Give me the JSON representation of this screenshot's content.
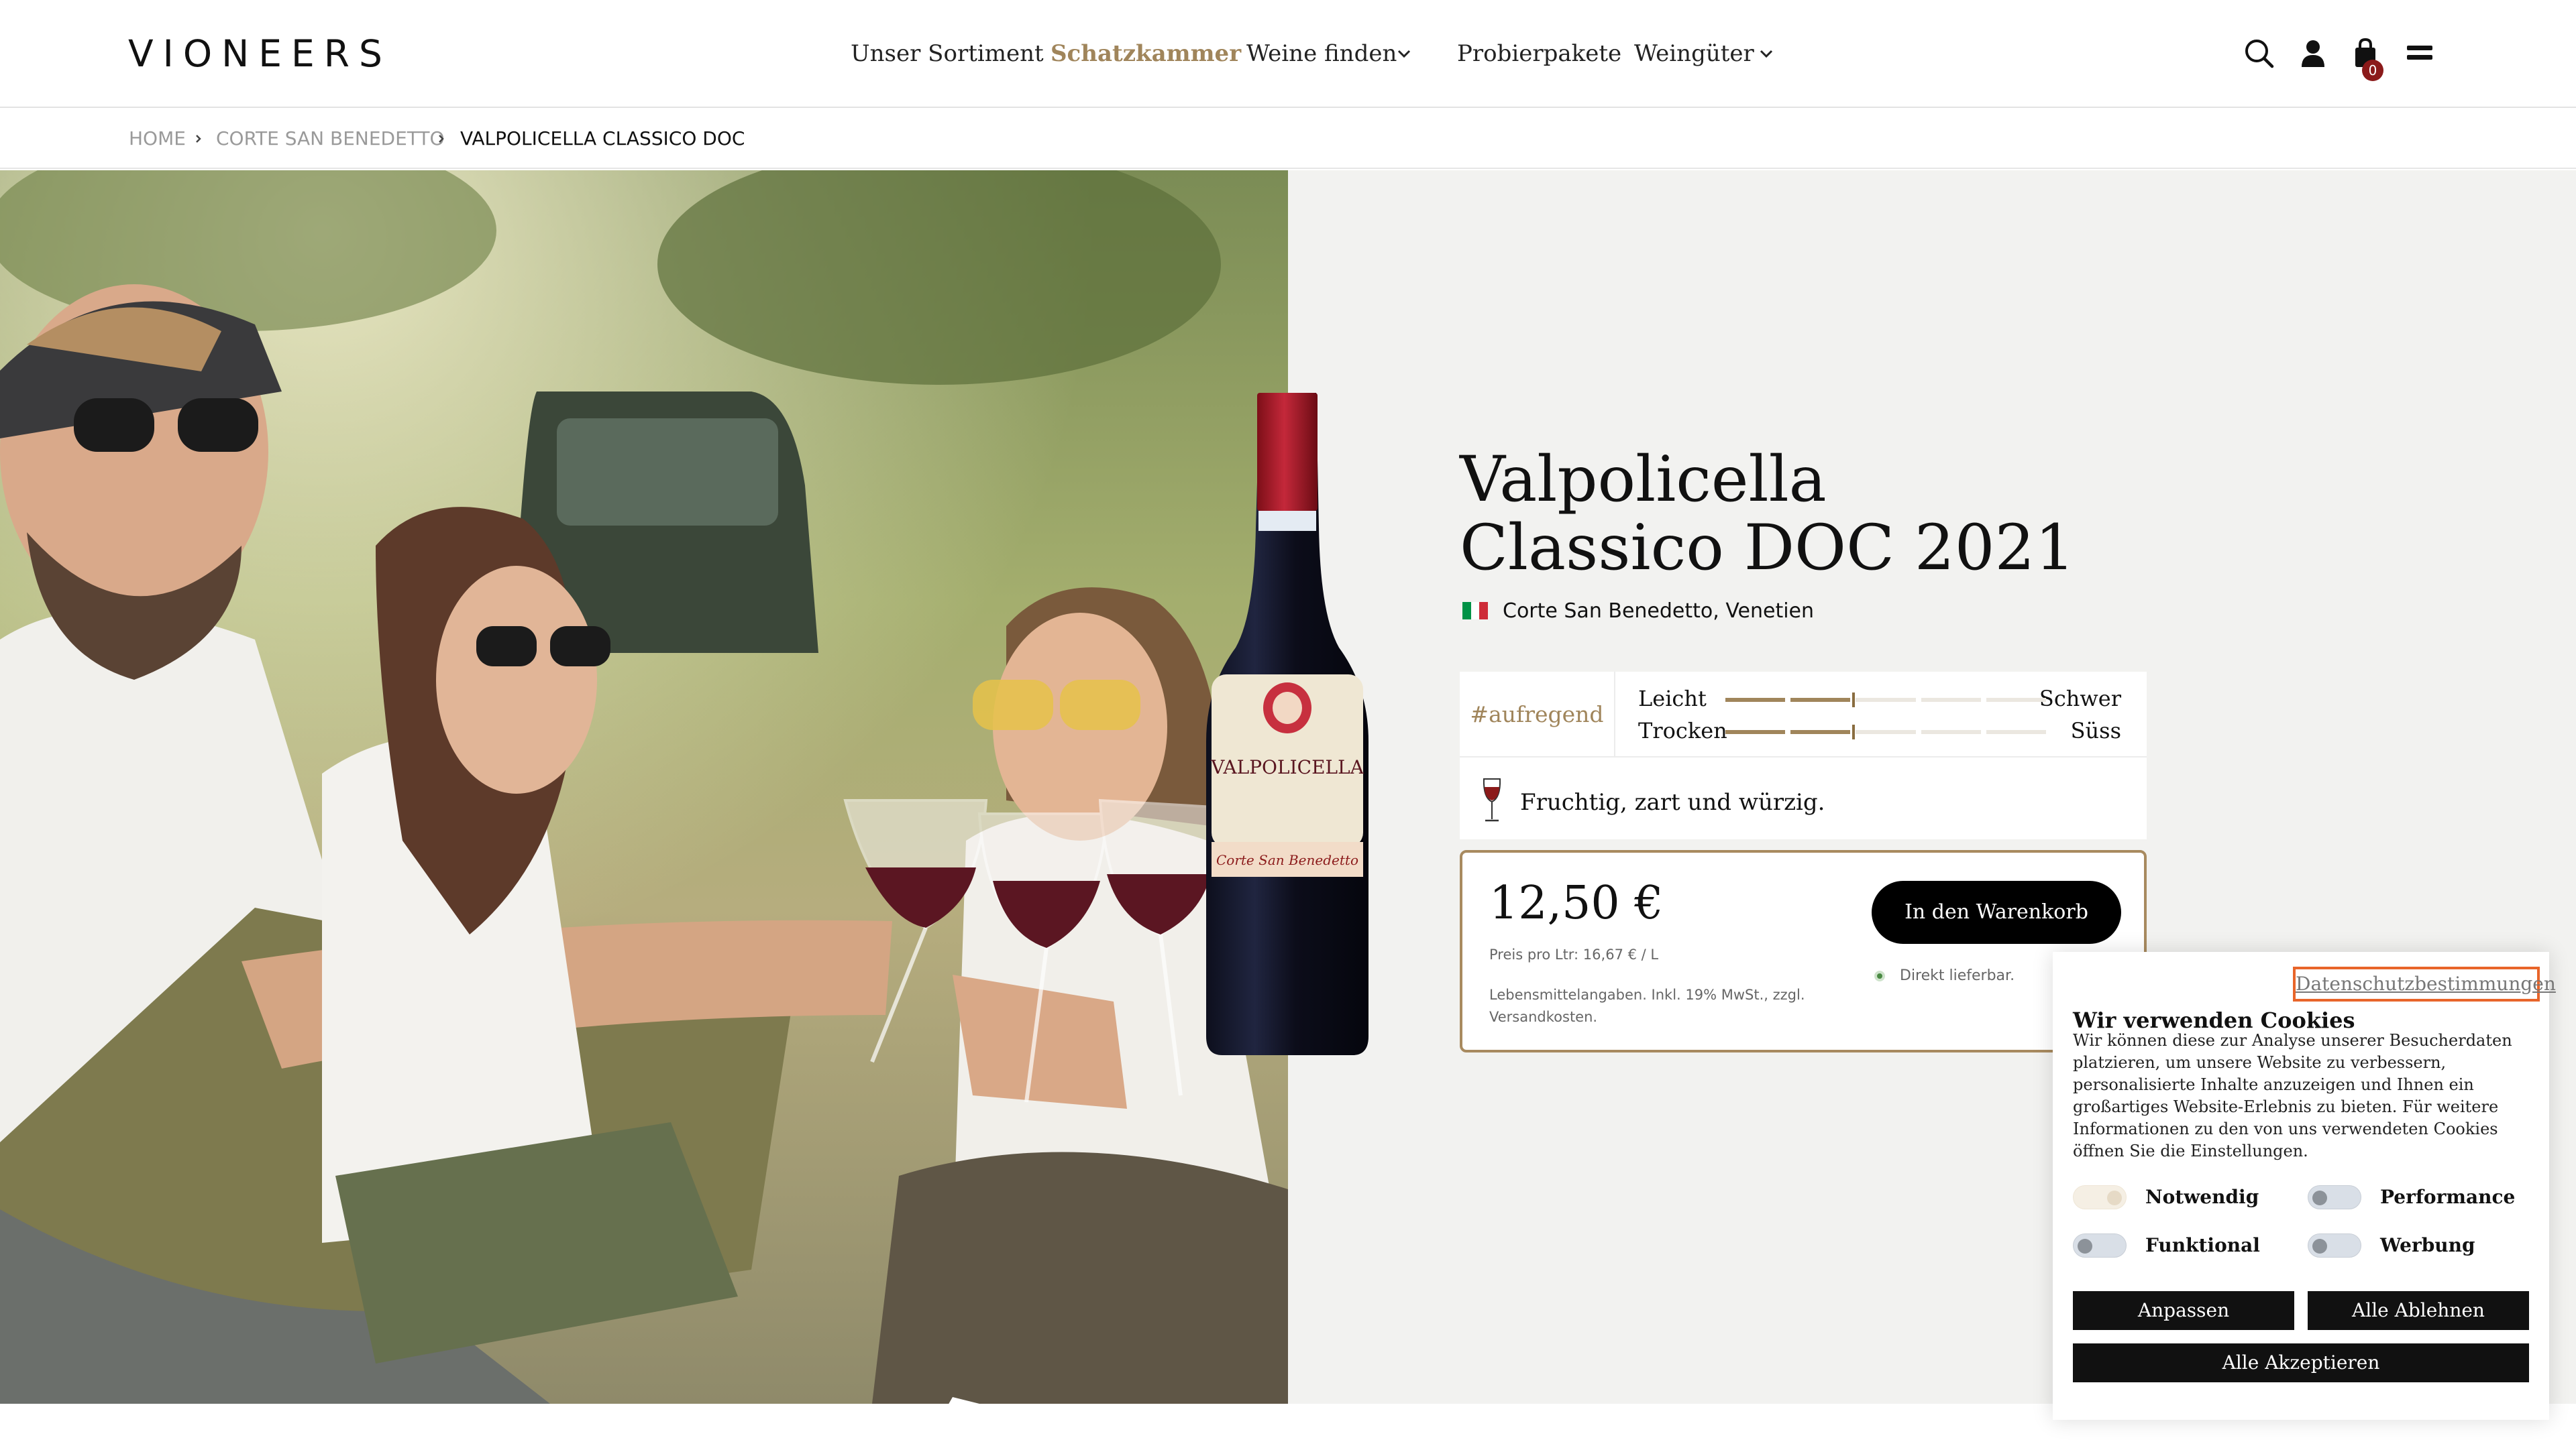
{
  "header": {
    "logo": "VIONEERS",
    "nav": [
      {
        "label": "Unser Sortiment"
      },
      {
        "label": "Schatzkammer"
      },
      {
        "label": "Weine finden"
      },
      {
        "label": "Probierpakete"
      },
      {
        "label": "Weingüter"
      }
    ],
    "cart_count": "0"
  },
  "breadcrumb": [
    "HOME",
    "CORTE SAN BENEDETTO",
    "VALPOLICELLA CLASSICO DOC"
  ],
  "product": {
    "title_line1": "Valpolicella",
    "title_line2": "Classico DOC 2021",
    "origin": "Corte San Benedetto, Venetien",
    "hashtag": "#aufregend",
    "scales": [
      {
        "left": "Leicht",
        "right": "Schwer",
        "value": 0.4
      },
      {
        "left": "Trocken",
        "right": "Süss",
        "value": 0.4
      }
    ],
    "description": "Fruchtig, zart und würzig.",
    "price": "12,50 €",
    "price_per_liter": "Preis pro Ltr: 16,67 € / L",
    "legal": "Lebensmittelangaben. Inkl. 19% MwSt., zzgl. Versandkosten.",
    "cart_button": "In den Warenkorb",
    "availability": "Direkt lieferbar.",
    "bottle_label_name": "VALPOLICELLA",
    "bottle_label_producer": "Corte San Benedetto"
  },
  "cookie": {
    "privacy_link": "Datenschutzbestimmungen",
    "title": "Wir verwenden Cookies",
    "text": "Wir können diese zur Analyse unserer Besucherdaten platzieren, um unsere Website zu verbessern, personalisierte Inhalte anzuzeigen und Ihnen ein großartiges Website-Erlebnis zu bieten. Für weitere Informationen zu den von uns verwendeten Cookies öffnen Sie die Einstellungen.",
    "toggles": [
      {
        "label": "Notwendig",
        "on": true
      },
      {
        "label": "Performance",
        "on": false
      },
      {
        "label": "Funktional",
        "on": false
      },
      {
        "label": "Werbung",
        "on": false
      }
    ],
    "btn_customize": "Anpassen",
    "btn_reject": "Alle Ablehnen",
    "btn_accept": "Alle Akzeptieren"
  },
  "colors": {
    "accent": "#a0855b",
    "price_border": "#a88a5f",
    "focus_outline": "#e8652a",
    "wine": "#8b1a1a"
  }
}
